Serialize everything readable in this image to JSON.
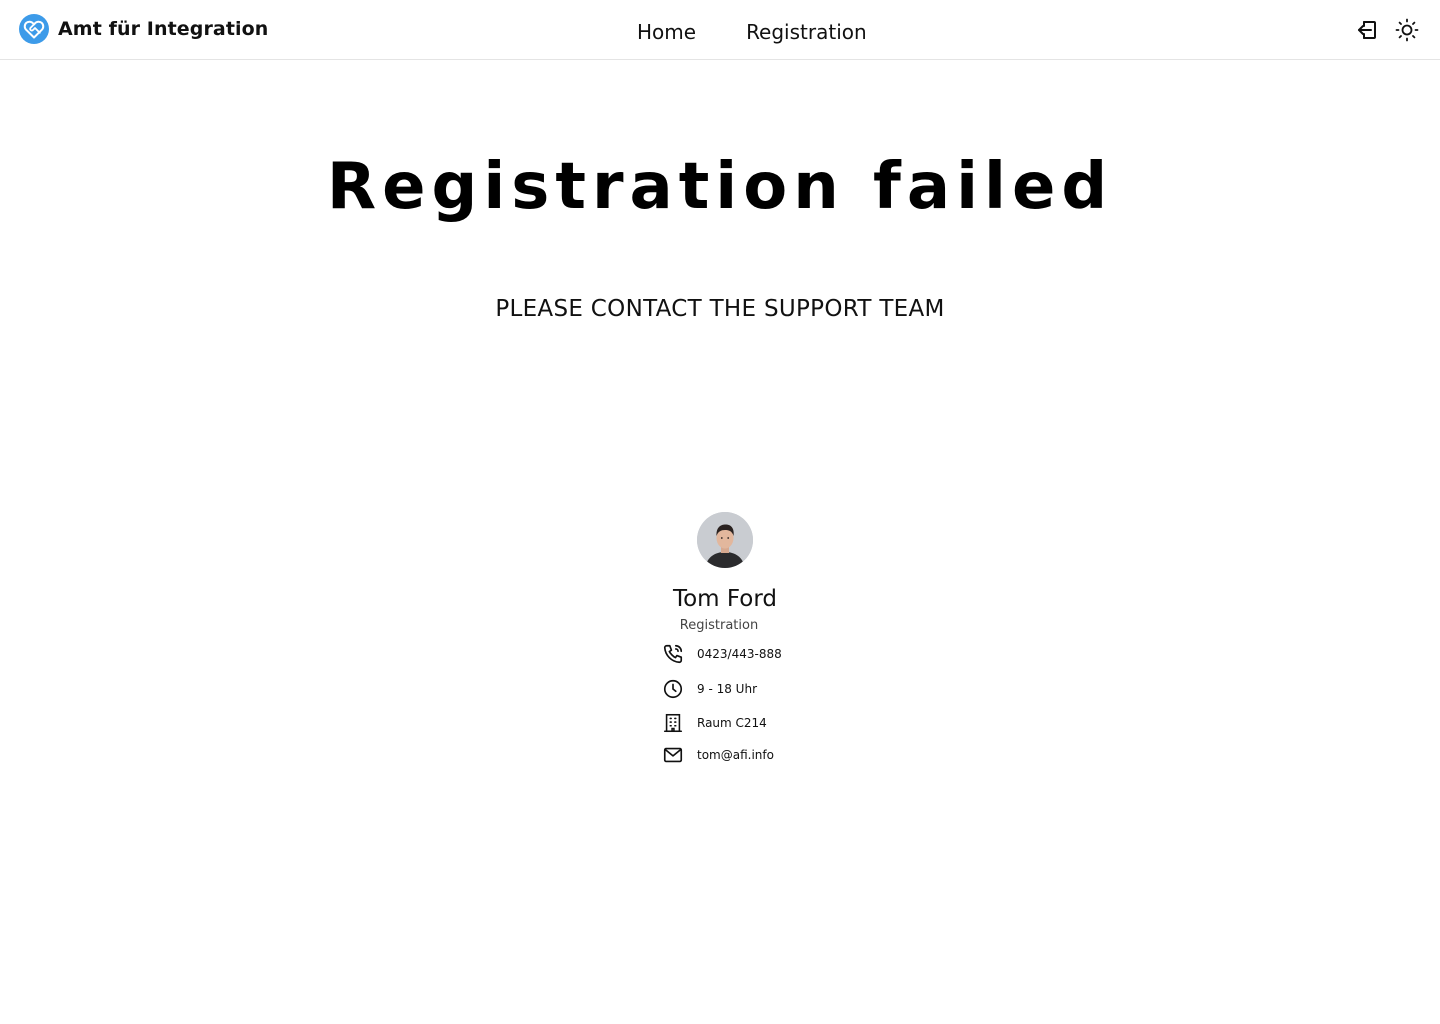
{
  "header": {
    "brand_name": "Amt für Integration",
    "brand_color": "#3d9be9",
    "logo_icon": "heart-handshake-icon",
    "nav": [
      {
        "label": "Home"
      },
      {
        "label": "Registration"
      }
    ],
    "actions": [
      {
        "icon": "login-icon"
      },
      {
        "icon": "sun-icon"
      }
    ]
  },
  "main": {
    "title": "Registration failed",
    "subtitle": "PLEASE CONTACT THE SUPPORT TEAM"
  },
  "contact": {
    "name": "Tom Ford",
    "role": "Registration",
    "details": [
      {
        "icon": "phone-icon",
        "value": "0423/443-888"
      },
      {
        "icon": "clock-icon",
        "value": "9 - 18 Uhr"
      },
      {
        "icon": "building-icon",
        "value": "Raum C214"
      },
      {
        "icon": "mail-icon",
        "value": "tom@afi.info"
      }
    ]
  }
}
